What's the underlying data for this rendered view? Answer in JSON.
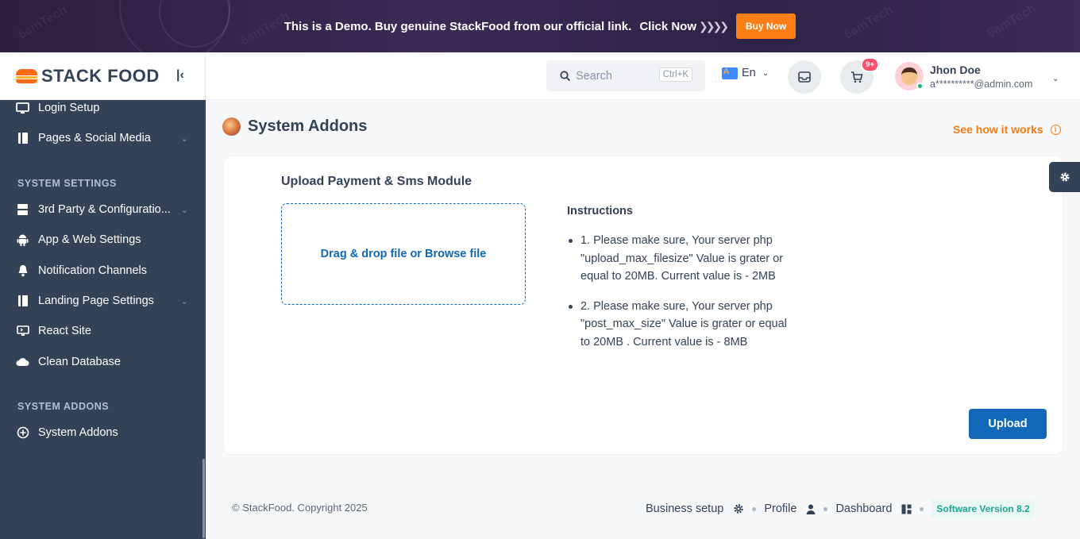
{
  "banner": {
    "text": "This is a Demo. Buy genuine StackFood from our official link.",
    "click_label": "Click Now",
    "buy_label": "Buy Now",
    "colors": {
      "button": "#fd7e14"
    }
  },
  "brand": {
    "logo_text": "STACK FOOD"
  },
  "sidebar": {
    "items_top": [
      {
        "label": "Login Setup",
        "icon": "monitor-icon"
      },
      {
        "label": "Pages & Social Media",
        "icon": "page-icon",
        "has_submenu": true
      }
    ],
    "section_settings": "SYSTEM SETTINGS",
    "items_settings": [
      {
        "label": "3rd Party & Configuratio...",
        "icon": "server-icon",
        "has_submenu": true
      },
      {
        "label": "App & Web Settings",
        "icon": "android-icon"
      },
      {
        "label": "Notification Channels",
        "icon": "bell-icon"
      },
      {
        "label": "Landing Page Settings",
        "icon": "page-icon",
        "has_submenu": true
      },
      {
        "label": "React Site",
        "icon": "react-icon"
      },
      {
        "label": "Clean Database",
        "icon": "cloud-icon"
      }
    ],
    "section_addons": "SYSTEM ADDONS",
    "items_addons": [
      {
        "label": "System Addons",
        "icon": "plus-circle-icon",
        "active": true
      }
    ]
  },
  "header": {
    "search_placeholder": "Search",
    "search_shortcut": "Ctrl+K",
    "language": "En",
    "cart_badge": "9+",
    "user_name": "Jhon Doe",
    "user_email": "a**********@admin.com"
  },
  "main": {
    "page_title": "System Addons",
    "see_how": "See how it works",
    "card_title": "Upload Payment & Sms Module",
    "dropzone_text": "Drag & drop file or Browse file",
    "instructions_title": "Instructions",
    "instructions": [
      "1. Please make sure, Your server php \"upload_max_filesize\" Value is grater or equal to 20MB. Current value is - 2MB",
      "2. Please make sure, Your server php \"post_max_size\" Value is grater or equal to 20MB . Current value is - 8MB"
    ],
    "upload_label": "Upload"
  },
  "footer": {
    "copyright": "© StackFood. Copyright 2025",
    "business_setup": "Business setup",
    "profile": "Profile",
    "dashboard": "Dashboard",
    "version": "Software Version 8.2"
  },
  "colors": {
    "sidebar_bg": "#334257",
    "primary": "#1168b8",
    "accent": "#f77a13"
  }
}
